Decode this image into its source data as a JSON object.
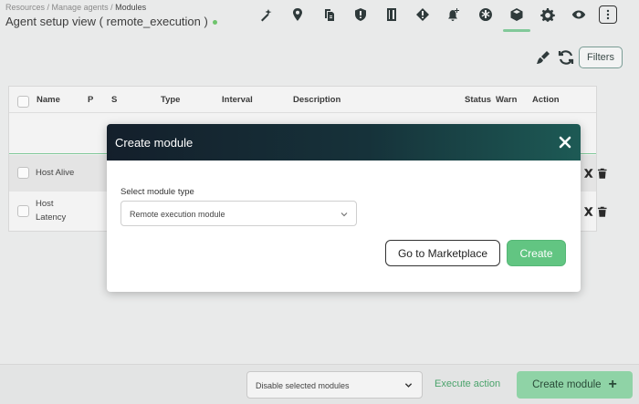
{
  "header": {
    "breadcrumb": {
      "level1": "Resources",
      "sep1": " / ",
      "level2": "Manage agents",
      "sep2": " / ",
      "current": "Modules"
    },
    "title": "Agent setup view ( remote_execution )",
    "status_color": "#6ec46c",
    "toolbar_icons": [
      "wand-icon",
      "location-pin-icon",
      "copy-files-icon",
      "shield-icon",
      "book-icon",
      "diamond-alert-icon",
      "bell-plus-icon",
      "snowflake-icon",
      "module-box-icon",
      "gear-icon",
      "eye-icon",
      "more-vertical-icon"
    ],
    "active_tab": "module-box-icon"
  },
  "actions": {
    "filters_label": "Filters"
  },
  "table": {
    "columns": [
      "Name",
      "P",
      "S",
      "Type",
      "Interval",
      "Description",
      "Status",
      "Warn",
      "Action"
    ],
    "rows": [
      {
        "name": "Host Alive"
      },
      {
        "name_line1": "Host",
        "name_line2": "Latency"
      }
    ]
  },
  "modal": {
    "title": "Create module",
    "select_label": "Select module type",
    "select_value": "Remote execution module",
    "marketplace_button": "Go to Marketplace",
    "create_button": "Create"
  },
  "footer": {
    "bulk_select_value": "Disable selected modules",
    "execute_label": "Execute action",
    "create_module_label": "Create module",
    "create_module_icon": "+"
  },
  "colors": {
    "accent": "#62c582",
    "header_dark": "#141f2b"
  }
}
